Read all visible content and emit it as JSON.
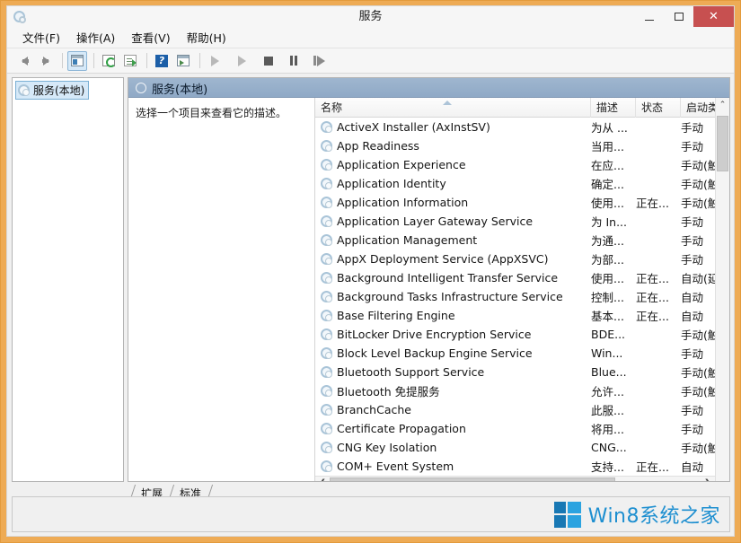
{
  "window": {
    "title": "服务",
    "app_icon": "services-gear-icon",
    "border_color": "#eeab55",
    "buttons": {
      "minimize": "minimize-icon",
      "maximize": "maximize-icon",
      "close": "✕"
    }
  },
  "menu": {
    "items": [
      {
        "label": "文件(F)",
        "name": "menu-file"
      },
      {
        "label": "操作(A)",
        "name": "menu-action"
      },
      {
        "label": "查看(V)",
        "name": "menu-view"
      },
      {
        "label": "帮助(H)",
        "name": "menu-help"
      }
    ]
  },
  "toolbar": {
    "buttons": [
      {
        "name": "back-button",
        "icon": "arrow-left-icon"
      },
      {
        "name": "forward-button",
        "icon": "arrow-right-icon"
      },
      {
        "name": "show-hide-tree-button",
        "icon": "console-tree-icon",
        "active": true
      },
      {
        "name": "refresh-button",
        "icon": "refresh-icon"
      },
      {
        "name": "export-list-button",
        "icon": "export-icon"
      },
      {
        "name": "help-button",
        "icon": "help-icon"
      },
      {
        "name": "properties-button",
        "icon": "properties-icon"
      },
      {
        "name": "start-service-button",
        "icon": "play-icon"
      },
      {
        "name": "resume-service-button",
        "icon": "play-icon"
      },
      {
        "name": "stop-service-button",
        "icon": "stop-icon"
      },
      {
        "name": "pause-service-button",
        "icon": "pause-icon"
      },
      {
        "name": "restart-service-button",
        "icon": "restart-icon"
      }
    ]
  },
  "tree": {
    "root_label": "服务(本地)",
    "root_icon": "services-gear-icon"
  },
  "detail_pane": {
    "header_title": "服务(本地)",
    "header_icon": "circle-icon",
    "description": "选择一个项目来查看它的描述。"
  },
  "list": {
    "columns": [
      {
        "label": "名称",
        "name": "column-name",
        "sorted": "asc"
      },
      {
        "label": "描述",
        "name": "column-description"
      },
      {
        "label": "状态",
        "name": "column-status"
      },
      {
        "label": "启动类",
        "name": "column-startup-type"
      }
    ],
    "rows": [
      {
        "icon": "service-gear-icon",
        "name": "ActiveX Installer (AxInstSV)",
        "desc": "为从 ...",
        "state": "",
        "start": "手动"
      },
      {
        "icon": "service-gear-icon",
        "name": "App Readiness",
        "desc": "当用...",
        "state": "",
        "start": "手动"
      },
      {
        "icon": "service-gear-icon",
        "name": "Application Experience",
        "desc": "在应...",
        "state": "",
        "start": "手动(触"
      },
      {
        "icon": "service-gear-icon",
        "name": "Application Identity",
        "desc": "确定...",
        "state": "",
        "start": "手动(触"
      },
      {
        "icon": "service-gear-icon",
        "name": "Application Information",
        "desc": "使用...",
        "state": "正在...",
        "start": "手动(触"
      },
      {
        "icon": "service-gear-icon",
        "name": "Application Layer Gateway Service",
        "desc": "为 In...",
        "state": "",
        "start": "手动"
      },
      {
        "icon": "service-gear-icon",
        "name": "Application Management",
        "desc": "为通...",
        "state": "",
        "start": "手动"
      },
      {
        "icon": "service-gear-icon",
        "name": "AppX Deployment Service (AppXSVC)",
        "desc": "为部...",
        "state": "",
        "start": "手动"
      },
      {
        "icon": "service-gear-icon",
        "name": "Background Intelligent Transfer Service",
        "desc": "使用...",
        "state": "正在...",
        "start": "自动(延"
      },
      {
        "icon": "service-gear-icon",
        "name": "Background Tasks Infrastructure Service",
        "desc": "控制...",
        "state": "正在...",
        "start": "自动"
      },
      {
        "icon": "service-gear-icon",
        "name": "Base Filtering Engine",
        "desc": "基本...",
        "state": "正在...",
        "start": "自动"
      },
      {
        "icon": "service-gear-icon",
        "name": "BitLocker Drive Encryption Service",
        "desc": "BDE...",
        "state": "",
        "start": "手动(触"
      },
      {
        "icon": "service-gear-icon",
        "name": "Block Level Backup Engine Service",
        "desc": "Win...",
        "state": "",
        "start": "手动"
      },
      {
        "icon": "service-gear-icon",
        "name": "Bluetooth Support Service",
        "desc": "Blue...",
        "state": "",
        "start": "手动(触"
      },
      {
        "icon": "service-gear-icon",
        "name": "Bluetooth 免提服务",
        "desc": "允许...",
        "state": "",
        "start": "手动(触"
      },
      {
        "icon": "service-gear-icon",
        "name": "BranchCache",
        "desc": "此服...",
        "state": "",
        "start": "手动"
      },
      {
        "icon": "service-gear-icon",
        "name": "Certificate Propagation",
        "desc": "将用...",
        "state": "",
        "start": "手动"
      },
      {
        "icon": "service-gear-icon",
        "name": "CNG Key Isolation",
        "desc": "CNG...",
        "state": "",
        "start": "手动(触"
      },
      {
        "icon": "service-gear-icon",
        "name": "COM+ Event System",
        "desc": "支持...",
        "state": "正在...",
        "start": "自动"
      }
    ]
  },
  "tabs": [
    {
      "label": "扩展",
      "name": "tab-extended"
    },
    {
      "label": "标准",
      "name": "tab-standard"
    }
  ],
  "watermark": {
    "text": "Win8系统之家",
    "logo": "windows-logo-icon",
    "color": "#1e8fd0"
  },
  "scrollbars": {
    "vertical_up": "▲",
    "vertical_down": "▼",
    "horizontal_left": "❮",
    "horizontal_right": "❯"
  }
}
